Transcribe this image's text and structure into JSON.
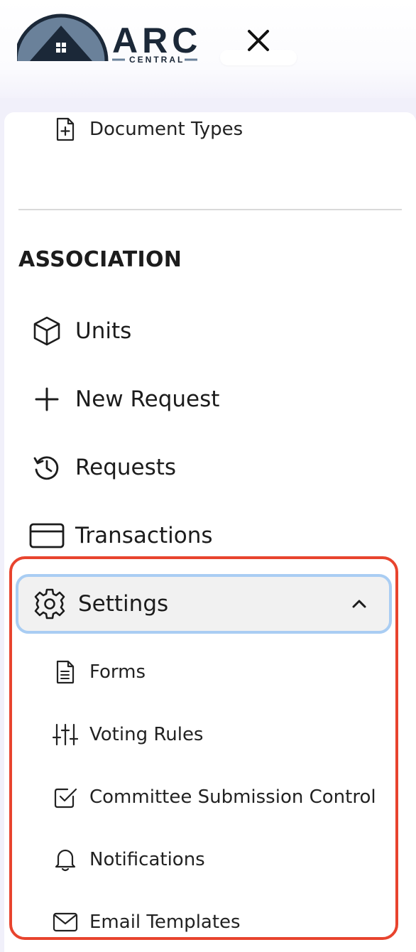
{
  "brand": {
    "word": "ARC",
    "sub": "CENTRAL"
  },
  "header": {
    "close_icon": "close-icon"
  },
  "menu": {
    "document_types": {
      "label": "Document Types",
      "icon": "file-plus-icon"
    },
    "section_title": "ASSOCIATION",
    "items": [
      {
        "label": "Units",
        "icon": "cube-icon"
      },
      {
        "label": "New Request",
        "icon": "plus-icon"
      },
      {
        "label": "Requests",
        "icon": "history-icon"
      },
      {
        "label": "Transactions",
        "icon": "credit-card-icon"
      }
    ],
    "settings": {
      "label": "Settings",
      "icon": "gear-icon",
      "expanded": true,
      "children": [
        {
          "label": "Forms",
          "icon": "file-text-icon"
        },
        {
          "label": "Voting Rules",
          "icon": "sliders-icon"
        },
        {
          "label": "Committee Submission Control",
          "icon": "check-square-icon"
        },
        {
          "label": "Notifications",
          "icon": "bell-icon"
        },
        {
          "label": "Email Templates",
          "icon": "mail-icon"
        }
      ]
    }
  },
  "colors": {
    "highlight_outline": "#e8442e",
    "focus_ring": "#a9cdf3",
    "active_bg": "#f1f1f1",
    "logo_navy": "#1b2838",
    "logo_steel": "#6a819a"
  }
}
